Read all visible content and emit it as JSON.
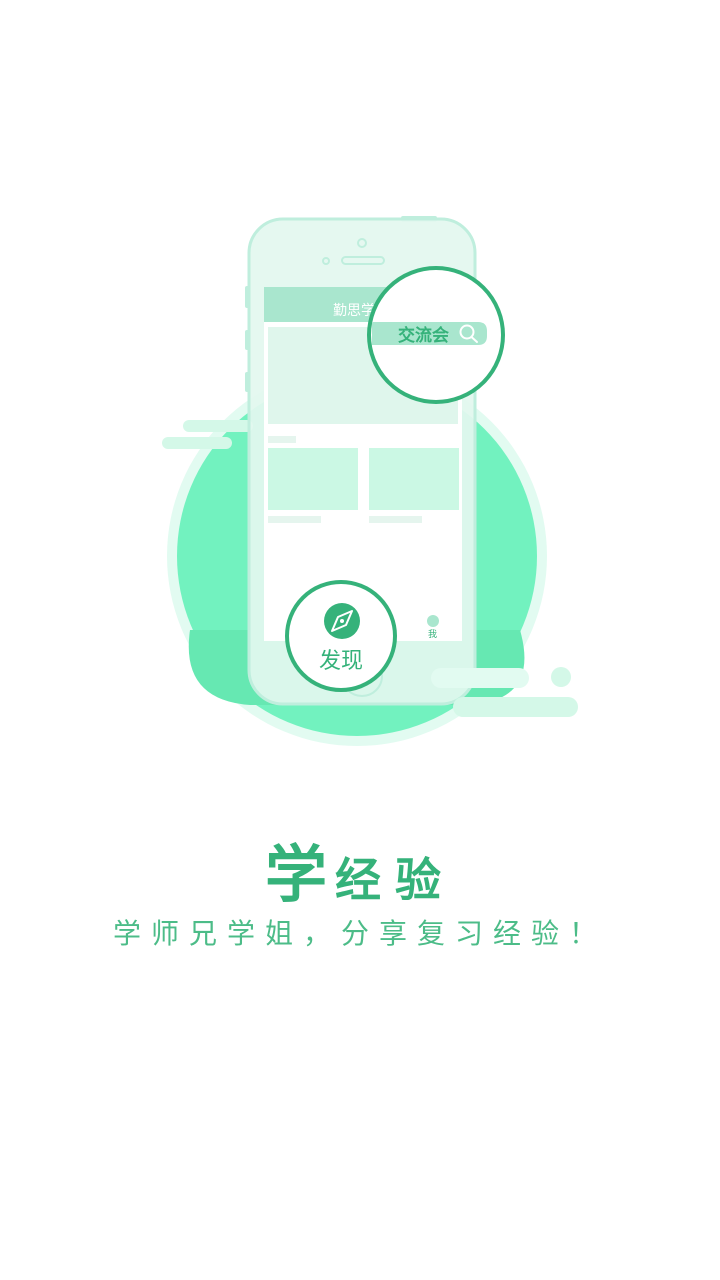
{
  "illustration": {
    "app_header_title": "勤思学",
    "search_label": "交流会",
    "discover_label": "发现",
    "tab_me_label": "我",
    "colors": {
      "brand_green": "#35b27a",
      "blob_green": "#72f2bf",
      "light_mint": "#d4f8e8",
      "phone_body": "#e3f7ef"
    }
  },
  "headline": {
    "big_char": "学",
    "rest": "经验"
  },
  "subtitle": "学师兄学姐，分享复习经验！"
}
